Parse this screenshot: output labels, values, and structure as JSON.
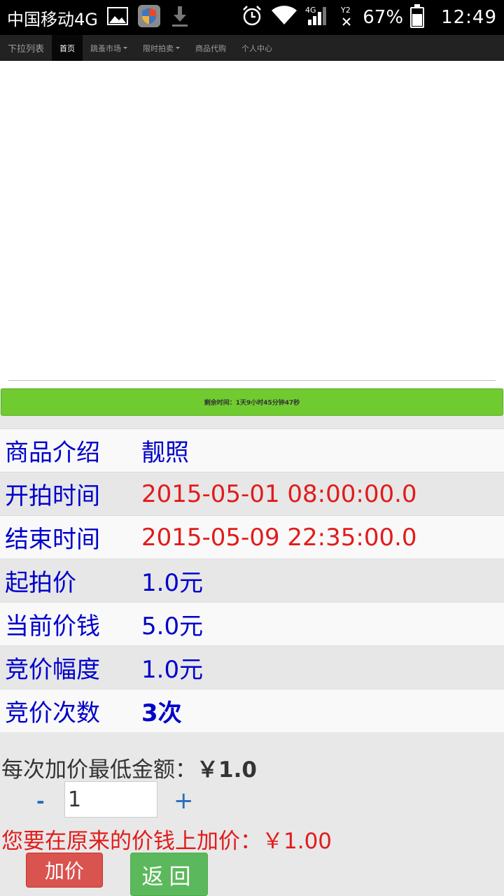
{
  "status_bar": {
    "carrier": "中国移动4G",
    "battery": "67%",
    "battery_level": 0.67,
    "time": "12:49"
  },
  "nav": {
    "brand": "下拉列表",
    "items": [
      {
        "label": "首页",
        "active": true
      },
      {
        "label": "跳蚤市场",
        "dropdown": true
      },
      {
        "label": "限时拍卖",
        "dropdown": true
      },
      {
        "label": "商品代购"
      },
      {
        "label": "个人中心"
      }
    ]
  },
  "countdown": {
    "label": "剩余时间：",
    "value": "1天9小时45分钟47秒"
  },
  "details": [
    {
      "label": "商品介绍",
      "value": "靓照"
    },
    {
      "label": "开拍时间",
      "value": "2015-05-01 08:00:00.0"
    },
    {
      "label": "结束时间",
      "value": "2015-05-09 22:35:00.0"
    },
    {
      "label": "起拍价",
      "value": "1.0元"
    },
    {
      "label": "当前价钱",
      "value": "5.0元"
    },
    {
      "label": "竞价幅度",
      "value": "1.0元"
    },
    {
      "label": "竞价次数",
      "value": "3次"
    }
  ],
  "bid": {
    "min_label": "每次加价最低金额：",
    "min_value": "￥1.0",
    "minus": "-",
    "qty": "1",
    "plus": "+",
    "add_label": "您要在原来的价钱上加价：",
    "add_value": "￥1.00",
    "bid_button": "加价",
    "back_button": "返回"
  },
  "colors": {
    "label_blue": "#0000cc",
    "value_red": "#e21b1b",
    "countdown_green": "#6fcb30",
    "bid_red": "#d9534f",
    "back_green": "#5cb85c"
  }
}
